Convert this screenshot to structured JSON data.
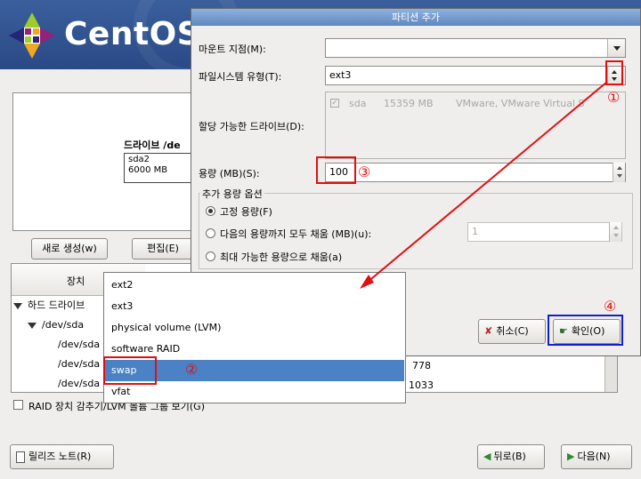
{
  "brand": {
    "name": "CentOS"
  },
  "dialog": {
    "title": "파티션 추가",
    "mount_label": "마운트 지점(M):",
    "mount_value": "",
    "fs_label": "파일시스템 유형(T):",
    "fs_value": "ext3",
    "drives_label": "할당 가능한 드라이브(D):",
    "drive": {
      "name": "sda",
      "size": "15359 MB",
      "model": "VMware, VMware Virtual S"
    },
    "size_label": "용량 (MB)(S):",
    "size_value": "100",
    "options_title": "추가 용량 옵션",
    "opt_fixed": "고정 용량(F)",
    "opt_fill_upto": "다음의 용량까지 모두 채움 (MB)(u):",
    "opt_fill_upto_value": "1",
    "opt_fill_max": "최대 가능한 용량으로 채움(a)",
    "cancel_label": "취소(C)",
    "ok_label": "확인(O)"
  },
  "fs_options": [
    "ext2",
    "ext3",
    "physical volume (LVM)",
    "software RAID",
    "swap",
    "vfat"
  ],
  "fs_selected": "swap",
  "background": {
    "drive_heading": "드라이브 /de",
    "drive_block_name": "sda2",
    "drive_block_size": "6000 MB",
    "new_button": "새로 생성(w)",
    "edit_button": "편집(E)",
    "col_device": "장치",
    "tree": [
      "하드 드라이브",
      "/dev/sda",
      "/dev/sda",
      "/dev/sda",
      "/dev/sda"
    ],
    "num_cells": [
      "778",
      "1033"
    ],
    "raid_checkbox": "RAID 장치 감추기/LVM 볼륨 그룹 보기(G)"
  },
  "footer": {
    "release_notes": "릴리즈 노트(R)",
    "back": "뒤로(B)",
    "next": "다음(N)"
  },
  "annotations": {
    "n1": "①",
    "n2": "②",
    "n3": "③",
    "n4": "④"
  },
  "colors": {
    "annotation_red": "#e01010",
    "annotation_blue": "#1020d0",
    "selection": "#4a82c5"
  }
}
